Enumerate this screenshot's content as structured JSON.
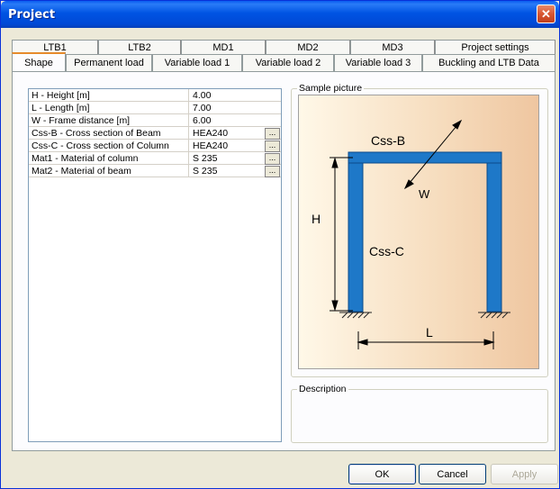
{
  "window": {
    "title": "Project",
    "close_glyph": "✕"
  },
  "tabs_back": [
    "LTB1",
    "LTB2",
    "MD1",
    "MD2",
    "MD3",
    "Project settings"
  ],
  "tabs_front": [
    "Shape",
    "Permanent load",
    "Variable load 1",
    "Variable load 2",
    "Variable load 3",
    "Buckling and LTB Data"
  ],
  "active_tab": "Shape",
  "properties": [
    {
      "label": "H - Height [m]",
      "value": "4.00",
      "has_browse": false
    },
    {
      "label": "L - Length [m]",
      "value": "7.00",
      "has_browse": false
    },
    {
      "label": "W - Frame distance [m]",
      "value": "6.00",
      "has_browse": false
    },
    {
      "label": "Css-B - Cross section of Beam",
      "value": "HEA240",
      "has_browse": true
    },
    {
      "label": "Css-C - Cross section of Column",
      "value": "HEA240",
      "has_browse": true
    },
    {
      "label": "Mat1 - Material of column",
      "value": "S 235",
      "has_browse": true
    },
    {
      "label": "Mat2 - Material of beam",
      "value": "S 235",
      "has_browse": true
    }
  ],
  "browse_label": "...",
  "sample_picture": {
    "legend": "Sample picture",
    "labels": {
      "beam": "Css-B",
      "column": "Css-C",
      "height": "H",
      "length": "L",
      "width": "W"
    },
    "colors": {
      "frame": "#1e78c8",
      "frame_edge": "#0a4a8a",
      "background_start": "#fff8e8",
      "background_end": "#efc6a0"
    }
  },
  "description": {
    "legend": "Description",
    "text": ""
  },
  "buttons": {
    "ok": "OK",
    "cancel": "Cancel",
    "apply": "Apply"
  }
}
